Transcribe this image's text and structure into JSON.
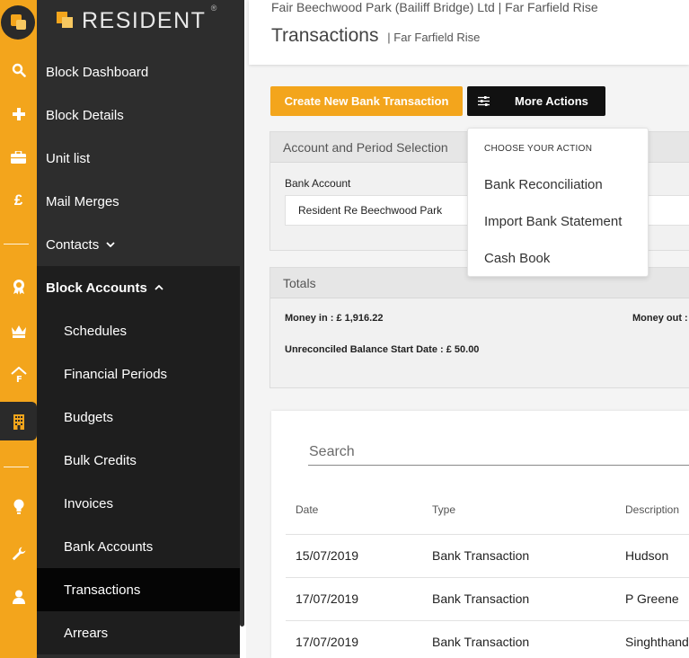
{
  "brand": {
    "name": "RESIDENT",
    "reg_mark": "®"
  },
  "rail_icons": [
    "logo-icon",
    "search-icon",
    "plus-icon",
    "briefcase-icon",
    "pound-icon",
    "award-icon",
    "crown-icon",
    "house-f-icon",
    "building-icon",
    "bulb-icon",
    "wrench-icon",
    "user-icon"
  ],
  "sidebar": {
    "items": [
      {
        "label": "Block Dashboard"
      },
      {
        "label": "Block Details"
      },
      {
        "label": "Unit list"
      },
      {
        "label": "Mail Merges"
      },
      {
        "label": "Contacts",
        "chevron": "⌄"
      },
      {
        "label": "Block Accounts",
        "chevron": "⌃"
      },
      {
        "label": "Schedules"
      },
      {
        "label": "Financial Periods"
      },
      {
        "label": "Budgets"
      },
      {
        "label": "Bulk Credits"
      },
      {
        "label": "Invoices"
      },
      {
        "label": "Bank Accounts"
      },
      {
        "label": "Transactions"
      },
      {
        "label": "Arrears"
      }
    ]
  },
  "header": {
    "breadcrumb": "Fair Beechwood Park (Bailiff Bridge) Ltd  |  Far Farfield Rise",
    "title": "Transactions",
    "subtitle": "| Far Farfield Rise"
  },
  "toolbar": {
    "create_label": "Create New Bank Transaction",
    "more_label": "More Actions"
  },
  "dropdown": {
    "heading": "CHOOSE YOUR ACTION",
    "items": [
      "Bank Reconciliation",
      "Import Bank Statement",
      "Cash Book"
    ]
  },
  "account_panel": {
    "title": "Account and Period Selection",
    "bank_account_label": "Bank Account",
    "bank_account_value": "Resident Re Beechwood Park"
  },
  "totals": {
    "title": "Totals",
    "money_in": "Money in : £ 1,916.22",
    "money_out": "Money out :",
    "unreconciled": "Unreconciled Balance Start Date : £ 50.00"
  },
  "table": {
    "search_placeholder": "Search",
    "columns": [
      "Date",
      "Type",
      "Description"
    ],
    "rows": [
      [
        "15/07/2019",
        "Bank Transaction",
        "Hudson"
      ],
      [
        "17/07/2019",
        "Bank Transaction",
        "P Greene"
      ],
      [
        "17/07/2019",
        "Bank Transaction",
        "Singhthandi"
      ]
    ]
  },
  "colors": {
    "accent": "#f3a51c",
    "sidebar": "#2d2d2d",
    "sidebar_section": "#1e1e1e",
    "active": "#050505"
  }
}
